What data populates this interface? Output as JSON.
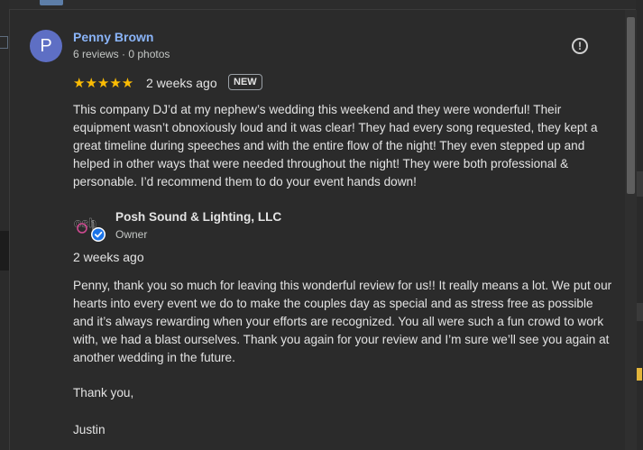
{
  "review": {
    "avatar_initial": "P",
    "reviewer_name": "Penny Brown",
    "reviewer_meta": "6 reviews · 0 photos",
    "rating": 5,
    "stars": "★★★★★",
    "date": "2 weeks ago",
    "badge": "NEW",
    "text": "This company DJ’d at my nephew’s wedding this weekend and they were wonderful! Their equipment wasn’t obnoxiously loud and it was clear! They had every song requested, they kept a great timeline during speeches and with the entire flow of the night! They even stepped up and helped in other ways that were needed throughout the night! They were both professional & personable. I’d recommend them to do your event hands down!"
  },
  "owner_response": {
    "business_name": "Posh Sound & Lighting, LLC",
    "role": "Owner",
    "date": "2 weeks ago",
    "text": "Penny, thank you so much for leaving this wonderful review for us!! It really means a lot. We put our hearts into every event we do to make the couples day as special and as stress free as possible and it’s always rewarding when your efforts are recognized. You all were such a fun crowd to work with, we had a blast ourselves. Thank you again for your review and I’m sure we’ll see you again at another wedding in the future.",
    "closing": "Thank you,",
    "signature": "Justin"
  },
  "icons": {
    "flag": "report-flag-icon",
    "verified": "verified-check-icon"
  },
  "colors": {
    "accent": "#8ab4f8",
    "star": "#fbbc04",
    "avatar": "#5e6fc4",
    "verified": "#1a73e8"
  }
}
